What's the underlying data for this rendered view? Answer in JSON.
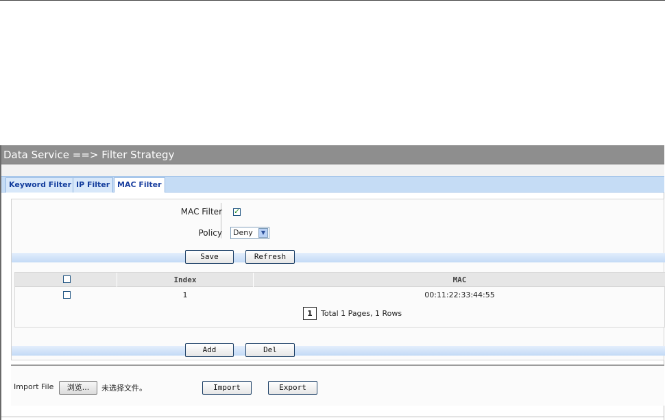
{
  "window": {
    "title": "Data Service ==> Filter Strategy"
  },
  "tabs": [
    {
      "label": "Keyword Filter",
      "active": false
    },
    {
      "label": "IP Filter",
      "active": false
    },
    {
      "label": "MAC Filter",
      "active": true
    }
  ],
  "form": {
    "mac_filter_label": "MAC Filter",
    "mac_filter_checked": true,
    "policy_label": "Policy",
    "policy_value": "Deny",
    "save_label": "Save",
    "refresh_label": "Refresh"
  },
  "table": {
    "columns": [
      "",
      "Index",
      "MAC"
    ],
    "rows": [
      {
        "checked": false,
        "index": "1",
        "mac": "00:11:22:33:44:55"
      }
    ],
    "pager_current": "1",
    "pager_summary": "Total 1 Pages, 1 Rows"
  },
  "actions": {
    "add_label": "Add",
    "del_label": "Del"
  },
  "import": {
    "label": "Import File",
    "browse_label": "浏览...",
    "file_status": "未选择文件。",
    "import_label": "Import",
    "export_label": "Export"
  },
  "colors": {
    "title_bar": "#8e8e8e",
    "tab_bar": "#c5dcf5",
    "tab_text": "#123c9c",
    "band": "#c3daf6"
  }
}
